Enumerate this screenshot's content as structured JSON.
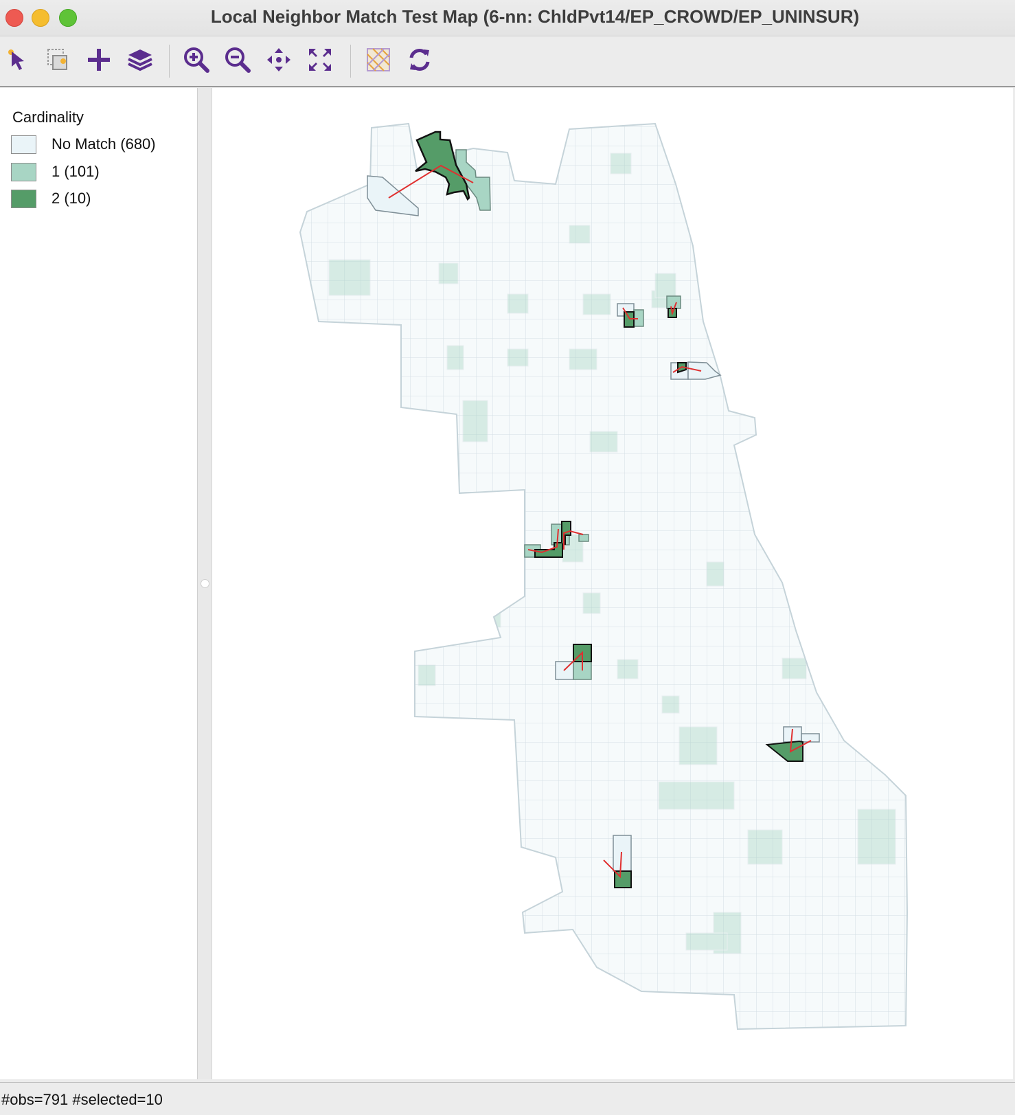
{
  "window": {
    "title": "Local Neighbor Match Test Map (6-nn: ChldPvt14/EP_CROWD/EP_UNINSUR)"
  },
  "toolbar": {
    "buttons": [
      {
        "name": "select-tool",
        "icon": "pointer-icon"
      },
      {
        "name": "selection-shape",
        "icon": "select-shape-icon"
      },
      {
        "name": "add-layer",
        "icon": "plus-icon"
      },
      {
        "name": "layers",
        "icon": "layers-icon"
      },
      {
        "name": "zoom-in",
        "icon": "zoom-in-icon"
      },
      {
        "name": "zoom-out",
        "icon": "zoom-out-icon"
      },
      {
        "name": "pan",
        "icon": "pan-arrows-icon"
      },
      {
        "name": "full-extent",
        "icon": "fit-extent-icon"
      },
      {
        "name": "basemap",
        "icon": "basemap-icon"
      },
      {
        "name": "refresh",
        "icon": "refresh-icon"
      }
    ],
    "icon_color": "#5b2d8e"
  },
  "legend": {
    "title": "Cardinality",
    "items": [
      {
        "label": "No Match (680)",
        "color": "#eaf4f8"
      },
      {
        "label": "1 (101)",
        "color": "#a8d5c4"
      },
      {
        "label": "2 (10)",
        "color": "#559c68"
      }
    ]
  },
  "map": {
    "base_fill": "#f6fafb",
    "outline_color": "#d4dfe4",
    "link_color": "#e03030"
  },
  "status": {
    "text": "#obs=791 #selected=10"
  }
}
